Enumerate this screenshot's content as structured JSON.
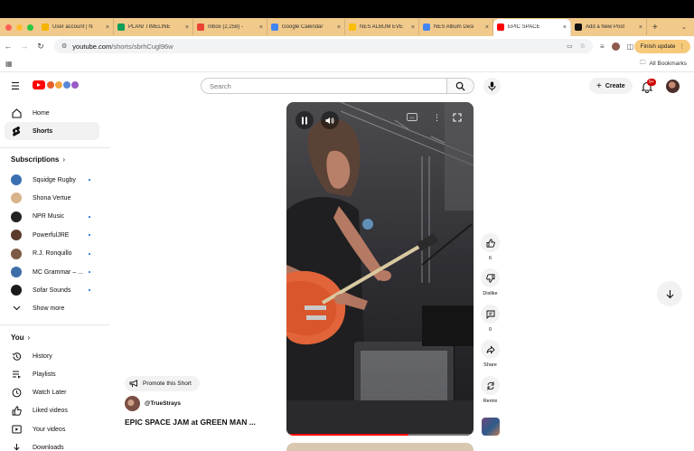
{
  "browser": {
    "tabs": [
      {
        "label": "User account | N",
        "icon_color": "#f4b400"
      },
      {
        "label": "PLAN/ TIMELINE",
        "icon_color": "#0f9d58"
      },
      {
        "label": "Inbox (2,258) -",
        "icon_color": "#ea4335"
      },
      {
        "label": "Google Calendar",
        "icon_color": "#4285f4"
      },
      {
        "label": "NES ALBUM EVE",
        "icon_color": "#fbbc04"
      },
      {
        "label": "NES Album Desi",
        "icon_color": "#4285f4"
      },
      {
        "label": "EPIC SPACE",
        "icon_color": "#ff0000",
        "active": true
      },
      {
        "label": "Add a New Post",
        "icon_color": "#111111"
      }
    ],
    "url_host": "youtube.com",
    "url_path": "/shorts/sbrhCugl96w",
    "finish_update": "Finish update",
    "all_bookmarks": "All Bookmarks"
  },
  "header": {
    "search_placeholder": "Search",
    "create_label": "Create",
    "notification_count": "9+"
  },
  "sidebar": {
    "nav": [
      {
        "label": "Home",
        "icon": "home-icon"
      },
      {
        "label": "Shorts",
        "icon": "shorts-icon",
        "selected": true
      }
    ],
    "subscriptions_title": "Subscriptions",
    "subscriptions": [
      {
        "label": "Squidge Rugby",
        "color": "#3a6fb0",
        "new": true
      },
      {
        "label": "Shona Vertue",
        "color": "#d8b48a",
        "new": false
      },
      {
        "label": "NPR Music",
        "color": "#222222",
        "new": true
      },
      {
        "label": "PowerfulJRE",
        "color": "#5b3b2c",
        "new": true
      },
      {
        "label": "R.J. Ronquillo",
        "color": "#7d5a45",
        "new": true
      },
      {
        "label": "MC Grammar – ...",
        "color": "#3d6ea8",
        "new": true
      },
      {
        "label": "Sofar Sounds",
        "color": "#1a1a1a",
        "new": true
      }
    ],
    "show_more": "Show more",
    "you_title": "You",
    "you_items": [
      {
        "label": "History",
        "icon": "history-icon"
      },
      {
        "label": "Playlists",
        "icon": "playlists-icon"
      },
      {
        "label": "Watch Later",
        "icon": "clock-icon"
      },
      {
        "label": "Liked videos",
        "icon": "thumbs-up-icon"
      },
      {
        "label": "Your videos",
        "icon": "video-icon"
      },
      {
        "label": "Downloads",
        "icon": "download-icon"
      }
    ]
  },
  "short": {
    "promote_label": "Promote this Short",
    "channel_handle": "@TrueStrays",
    "title": "EPIC SPACE JAM at GREEN MAN ...",
    "likes": "6",
    "dislike_label": "Dislike",
    "comments": "0",
    "share_label": "Share",
    "remix_label": "Remix",
    "progress_fraction": 0.65
  }
}
